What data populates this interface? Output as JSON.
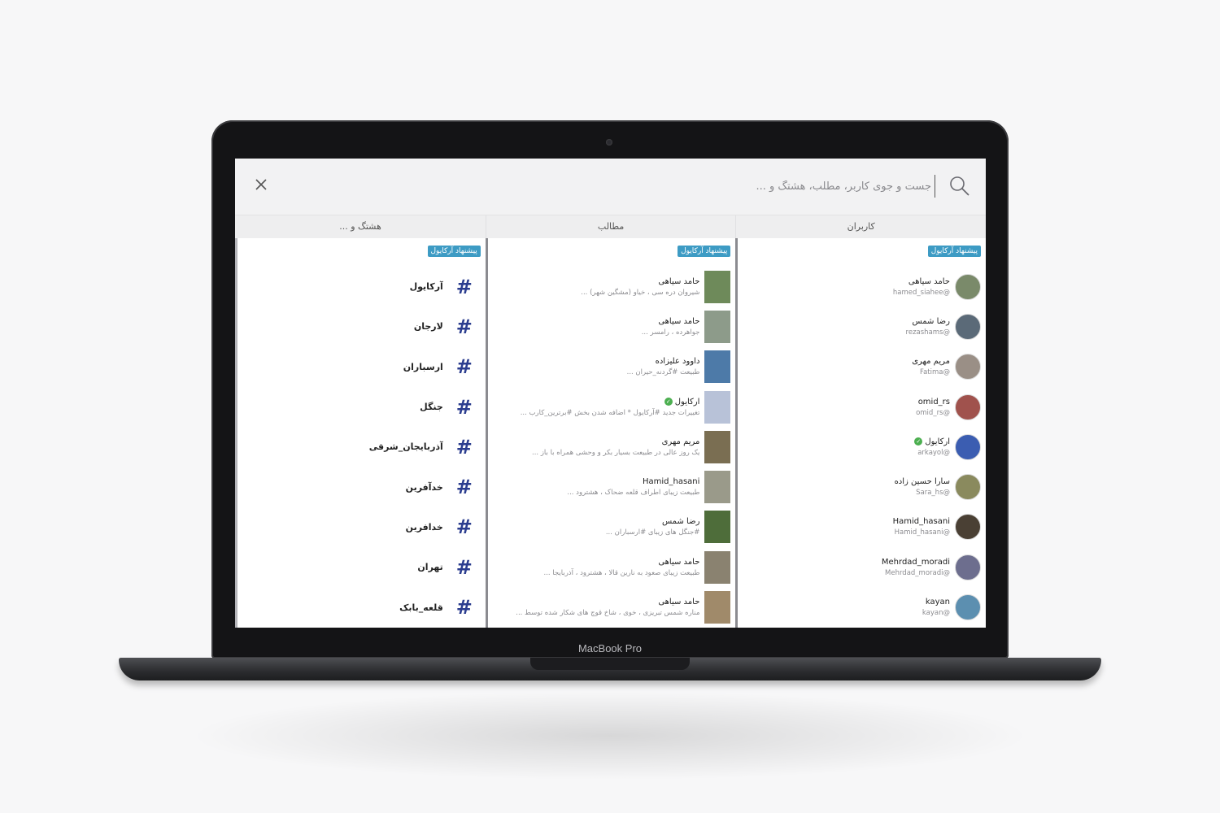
{
  "device": {
    "brand": "MacBook Pro"
  },
  "search": {
    "placeholder": "جست و جوی کاربر، مطلب، هشتگ و ..."
  },
  "icons": {
    "search": "search-icon",
    "close": "close-icon",
    "hashtag": "hash-icon",
    "verified": "verified-check-icon"
  },
  "colors": {
    "badge": "#3d9bc4",
    "hashtag": "#2b3d8f",
    "verified": "#4caf50"
  },
  "columns": {
    "users": {
      "header": "کاربران",
      "badge": "پیشنهاد آرکایول",
      "items": [
        {
          "name": "حامد سیاهی",
          "handle": "@hamed_siahee",
          "verified": false,
          "color": "#7a8a6a"
        },
        {
          "name": "رضا شمس",
          "handle": "@rezashams",
          "verified": false,
          "color": "#5b6a78"
        },
        {
          "name": "مریم مهری",
          "handle": "@Fatima",
          "verified": false,
          "color": "#9a8f86"
        },
        {
          "name": "omid_rs",
          "handle": "@omid_rs",
          "verified": false,
          "color": "#a0524d"
        },
        {
          "name": "آرکایول",
          "handle": "@arkayol",
          "verified": true,
          "color": "#3b5db1"
        },
        {
          "name": "سارا حسین زاده",
          "handle": "@Sara_hs",
          "verified": false,
          "color": "#8a8a5e"
        },
        {
          "name": "Hamid_hasani",
          "handle": "@Hamid_hasani",
          "verified": false,
          "color": "#4a4034"
        },
        {
          "name": "Mehrdad_moradi",
          "handle": "@Mehrdad_moradi",
          "verified": false,
          "color": "#6d6e8e"
        },
        {
          "name": "kayan",
          "handle": "@kayan",
          "verified": false,
          "color": "#5c8fb0"
        }
      ]
    },
    "posts": {
      "header": "مطالب",
      "badge": "پیشنهاد آرکایول",
      "items": [
        {
          "author": "حامد سیاهی",
          "text": "شیروان دره سی ، خیاو (مشگین شهر) ...",
          "verified": false,
          "color": "#6e8a5a"
        },
        {
          "author": "حامد سیاهی",
          "text": "جواهرده ، رامسر ...",
          "verified": false,
          "color": "#8d9b8a"
        },
        {
          "author": "داوود علیزاده",
          "text": "طبیعت #گردنه_حیران ...",
          "verified": false,
          "color": "#4d7aa8"
        },
        {
          "author": "آرکایول",
          "text": "تغییرات جدید #آرکایول * اضافه شدن بخش #برترین_کارب ...",
          "verified": true,
          "color": "#b8c2d8"
        },
        {
          "author": "مریم مهری",
          "text": "یک روز عالی در طبیعت بسیار بکر و وحشی همراه با باز ...",
          "verified": false,
          "color": "#7a6e52"
        },
        {
          "author": "Hamid_hasani",
          "text": "طبیعت زیبای اطراف قلعه ضحاک ، هشترود ...",
          "verified": false,
          "color": "#9a9a8a"
        },
        {
          "author": "رضا شمس",
          "text": "#جنگل های زیبای #ارسباران ...",
          "verified": false,
          "color": "#4e6d3a"
        },
        {
          "author": "حامد سیاهی",
          "text": "طبیعت زیبای صعود به نارین قالا ، هشترود ، آذربایجا ...",
          "verified": false,
          "color": "#8a8270"
        },
        {
          "author": "حامد سیاهی",
          "text": "مناره شمس تبریزی ، خوی ، شاخ قوچ های شکار شده توسط ...",
          "verified": false,
          "color": "#a08a6a"
        }
      ]
    },
    "hashtags": {
      "header": "هشتگ و ...",
      "badge": "پیشنهاد آرکایول",
      "items": [
        "آرکایول",
        "لارجان",
        "ارسباران",
        "جنگل",
        "آذربایجان_شرقی",
        "خدآفرین",
        "خدافرین",
        "تهران",
        "قلعه_بابک"
      ]
    }
  }
}
